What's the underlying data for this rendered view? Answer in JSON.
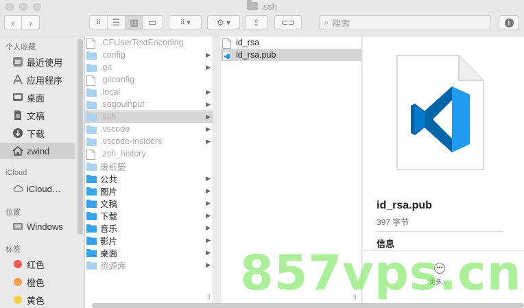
{
  "window": {
    "title": ".ssh"
  },
  "toolbar": {
    "search_placeholder": "搜索"
  },
  "sidebar": {
    "favorites_label": "个人收藏",
    "favorites": [
      {
        "label": "最近使用",
        "icon": "recents-icon"
      },
      {
        "label": "应用程序",
        "icon": "applications-icon"
      },
      {
        "label": "桌面",
        "icon": "desktop-icon"
      },
      {
        "label": "文稿",
        "icon": "documents-icon"
      },
      {
        "label": "下载",
        "icon": "downloads-icon"
      },
      {
        "label": "zwind",
        "icon": "home-icon",
        "selected": true
      }
    ],
    "icloud_label": "iCloud",
    "icloud": [
      {
        "label": "iCloud…",
        "icon": "cloud-icon"
      }
    ],
    "locations_label": "位置",
    "locations": [
      {
        "label": "Windows",
        "icon": "disk-icon"
      }
    ],
    "tags_label": "标签",
    "tags": [
      {
        "label": "红色",
        "color": "#f25c54"
      },
      {
        "label": "橙色",
        "color": "#f6a04d"
      },
      {
        "label": "黄色",
        "color": "#f7cf4a"
      }
    ]
  },
  "column1": [
    {
      "name": ".CFUserTextEncoding",
      "kind": "file",
      "hidden": true
    },
    {
      "name": ".config",
      "kind": "folder",
      "hidden": true,
      "arrow": true
    },
    {
      "name": ".git",
      "kind": "folder",
      "hidden": true,
      "arrow": true
    },
    {
      "name": ".gitconfig",
      "kind": "file",
      "hidden": true
    },
    {
      "name": ".local",
      "kind": "folder",
      "hidden": true,
      "arrow": true
    },
    {
      "name": ".sogouinput",
      "kind": "folder",
      "hidden": true,
      "arrow": true
    },
    {
      "name": ".ssh",
      "kind": "folder",
      "hidden": true,
      "arrow": true,
      "selected": true
    },
    {
      "name": ".vscode",
      "kind": "folder",
      "hidden": true,
      "arrow": true
    },
    {
      "name": ".vscode-insiders",
      "kind": "folder",
      "hidden": true,
      "arrow": true
    },
    {
      "name": ".zsh_history",
      "kind": "file",
      "hidden": true
    },
    {
      "name": "废纸篓",
      "kind": "folder",
      "hidden": true
    },
    {
      "name": "公共",
      "kind": "folder-blue",
      "arrow": true
    },
    {
      "name": "图片",
      "kind": "folder-blue",
      "arrow": true
    },
    {
      "name": "文稿",
      "kind": "folder-blue",
      "arrow": true
    },
    {
      "name": "下载",
      "kind": "folder-blue",
      "arrow": true
    },
    {
      "name": "音乐",
      "kind": "folder-blue",
      "arrow": true
    },
    {
      "name": "影片",
      "kind": "folder-blue",
      "arrow": true
    },
    {
      "name": "桌面",
      "kind": "folder-blue",
      "arrow": true
    },
    {
      "name": "资源库",
      "kind": "folder",
      "hidden": true,
      "arrow": true
    }
  ],
  "column2": [
    {
      "name": "id_rsa",
      "kind": "file"
    },
    {
      "name": "id_rsa.pub",
      "kind": "vscode-file",
      "selected": true
    }
  ],
  "preview": {
    "name": "id_rsa.pub",
    "size": "397 字节",
    "info_label": "信息",
    "more_label": "更多..."
  },
  "watermark": "857vps.cn"
}
